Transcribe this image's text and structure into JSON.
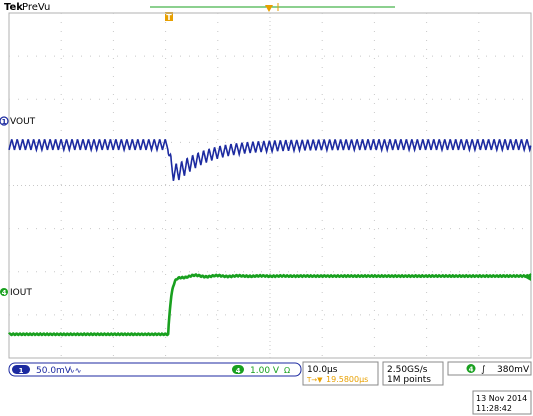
{
  "header": {
    "brand": "Tek",
    "mode": "PreVu"
  },
  "markers": {
    "trigger_pos_symbol": "T",
    "horizontal_pos_symbol": "◀"
  },
  "channels": [
    {
      "number": "1",
      "label": "VOUT",
      "color": "#1c2aa0",
      "badge_color": "#1c2aa0",
      "scale": "50.0mV",
      "coupling_symbol": "∿∿",
      "bandwidth_icon": "ac-coupling-icon"
    },
    {
      "number": "4",
      "label": "IOUT",
      "color": "#19a01f",
      "badge_color": "#19a01f",
      "scale": "1.00 V",
      "coupling_symbol": "Ω",
      "bandwidth_icon": "bw-limit-icon"
    }
  ],
  "timebase": {
    "scale": "10.0µs",
    "position": "19.5800µs",
    "position_prefix": "T→▼"
  },
  "acquisition": {
    "sample_rate": "2.50GS/s",
    "record_length": "1M points"
  },
  "trigger": {
    "channel": "4",
    "slope_symbol": "∫",
    "level": "380mV"
  },
  "datetime": {
    "date": "13 Nov 2014",
    "time": "11:28:42"
  },
  "waveform": {
    "grid": {
      "h_divs": 10,
      "v_divs": 8
    },
    "ch1": {
      "ripple_period_us": 1.05,
      "ripple_pp_div": 0.25,
      "baseline_div": 4.95,
      "event_us": 30.5
    },
    "ch4": {
      "low_div": 0.55,
      "high_div": 1.9,
      "edge_us": 30.5
    }
  }
}
